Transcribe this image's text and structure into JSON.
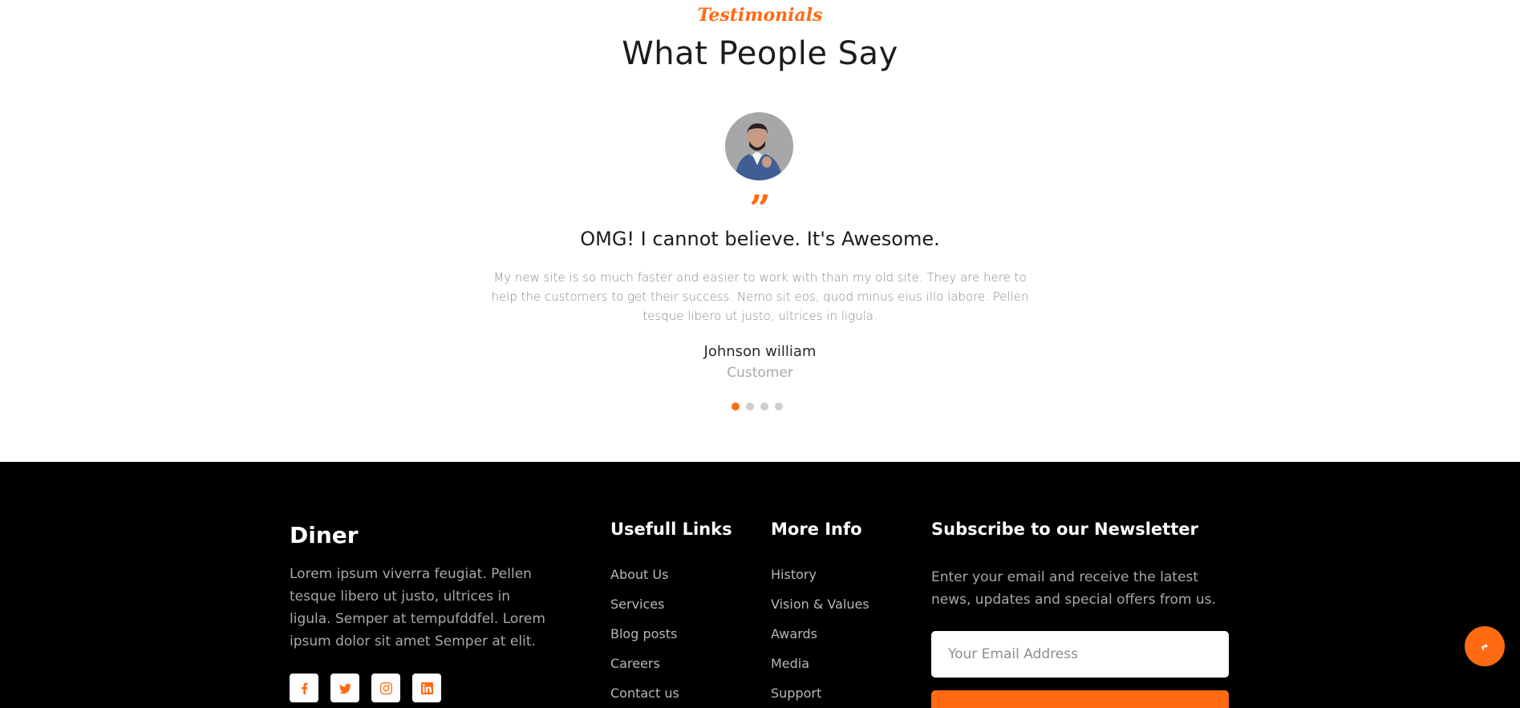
{
  "testimonials": {
    "kicker": "Testimonials",
    "heading": "What People Say",
    "avatar_icon": "person-avatar",
    "quote_icon": "quote-icon",
    "title": "OMG! I cannot believe. It's Awesome.",
    "body": "My new site is so much faster and easier to work with than my old site. They are here to help the customers to get their success. Nemo sit eos, quod minus eius illo labore. Pellen tesque libero ut justo, ultrices in ligula.",
    "name": "Johnson william",
    "role": "Customer",
    "slide_count": 4,
    "active_slide": 1
  },
  "footer": {
    "brand": "Diner",
    "about": "Lorem ipsum viverra feugiat. Pellen tesque libero ut justo, ultrices in ligula. Semper at tempufddfel. Lorem ipsum dolor sit amet Semper at elit.",
    "socials": [
      "facebook-icon",
      "twitter-icon",
      "instagram-icon",
      "linkedin-icon"
    ],
    "useful_links": {
      "title": "Usefull Links",
      "items": [
        "About Us",
        "Services",
        "Blog posts",
        "Careers",
        "Contact us"
      ]
    },
    "more_info": {
      "title": "More Info",
      "items": [
        "History",
        "Vision & Values",
        "Awards",
        "Media",
        "Support"
      ]
    },
    "newsletter": {
      "title": "Subscribe to our Newsletter",
      "description": "Enter your email and receive the latest news, updates and special offers from us.",
      "email_placeholder": "Your Email Address",
      "email_value": ""
    }
  },
  "colors": {
    "accent": "#ff6a13",
    "footer_bg": "#000000",
    "page_bg": "#ffffff"
  },
  "scroll_top_icon": "arrow-up-icon"
}
